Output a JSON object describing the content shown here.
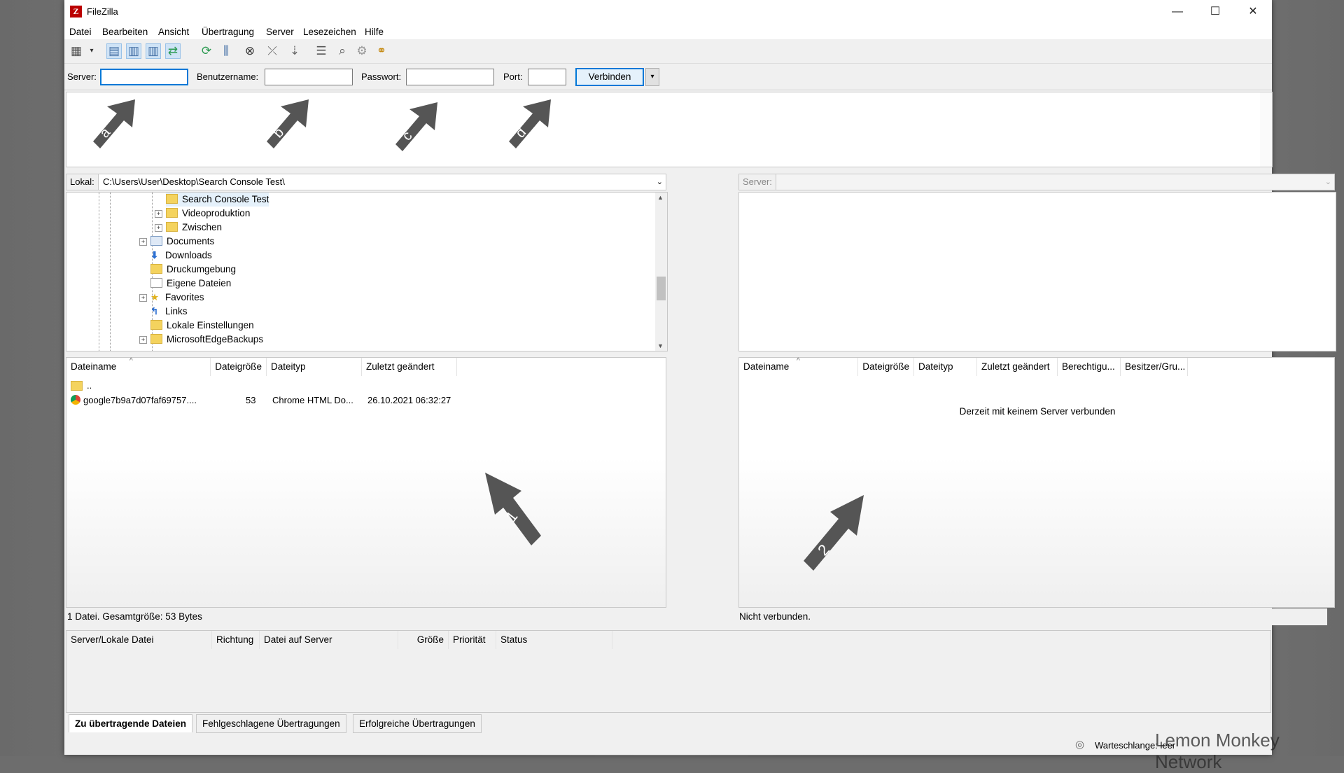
{
  "window": {
    "title": "FileZilla",
    "controls": [
      "—",
      "☐",
      "✕"
    ]
  },
  "menu": [
    "Datei",
    "Bearbeiten",
    "Ansicht",
    "Übertragung",
    "Server",
    "Lesezeichen",
    "Hilfe"
  ],
  "quickconnect": {
    "server_label": "Server:",
    "server_value": "",
    "user_label": "Benutzername:",
    "user_value": "",
    "password_label": "Passwort:",
    "password_value": "",
    "port_label": "Port:",
    "port_value": "",
    "connect_label": "Verbinden",
    "dropdown_icon": "▾"
  },
  "annotations": {
    "top_arrows": [
      "a",
      "b",
      "c",
      "d"
    ],
    "panel_arrows": [
      "1",
      "2"
    ],
    "arrow_color": "#555555"
  },
  "local": {
    "path_label": "Lokal:",
    "path_value": "C:\\Users\\User\\Desktop\\Search Console Test\\",
    "tree": [
      {
        "label": "Search Console Test",
        "icon": "folder-icon",
        "selected": true
      },
      {
        "label": "Videoproduktion",
        "icon": "folder-icon"
      },
      {
        "label": "Zwischen",
        "icon": "folder-icon"
      },
      {
        "label": "Documents",
        "icon": "documents-icon"
      },
      {
        "label": "Downloads",
        "icon": "download-icon"
      },
      {
        "label": "Druckumgebung",
        "icon": "folder-icon"
      },
      {
        "label": "Eigene Dateien",
        "icon": "documents-icon"
      },
      {
        "label": "Favorites",
        "icon": "star-icon"
      },
      {
        "label": "Links",
        "icon": "link-icon"
      },
      {
        "label": "Lokale Einstellungen",
        "icon": "folder-icon"
      },
      {
        "label": "MicrosoftEdgeBackups",
        "icon": "folder-icon"
      }
    ],
    "columns": [
      "Dateiname",
      "Dateigröße",
      "Dateityp",
      "Zuletzt geändert"
    ],
    "files": [
      {
        "name": "..",
        "size": "",
        "type": "",
        "modified": ""
      },
      {
        "name": "google7b9a7d07faf69757....",
        "size": "53",
        "type": "Chrome HTML Do...",
        "modified": "26.10.2021 06:32:27"
      }
    ],
    "status": "1 Datei. Gesamtgröße: 53 Bytes"
  },
  "remote": {
    "path_label": "Server:",
    "path_value": "",
    "columns": [
      "Dateiname",
      "Dateigröße",
      "Dateityp",
      "Zuletzt geändert",
      "Berechtigu...",
      "Besitzer/Gru..."
    ],
    "empty_message": "Derzeit mit keinem Server verbunden",
    "status": "Nicht verbunden."
  },
  "queue": {
    "columns": [
      "Server/Lokale Datei",
      "Richtung",
      "Datei auf Server",
      "Größe",
      "Priorität",
      "Status"
    ],
    "tabs": [
      "Zu übertragende Dateien",
      "Fehlgeschlagene Übertragungen",
      "Erfolgreiche Übertragungen"
    ],
    "active_tab": 0
  },
  "statusbar": {
    "queue_text": "Warteschlange: leer"
  },
  "watermark": "Lemon Monkey Network"
}
